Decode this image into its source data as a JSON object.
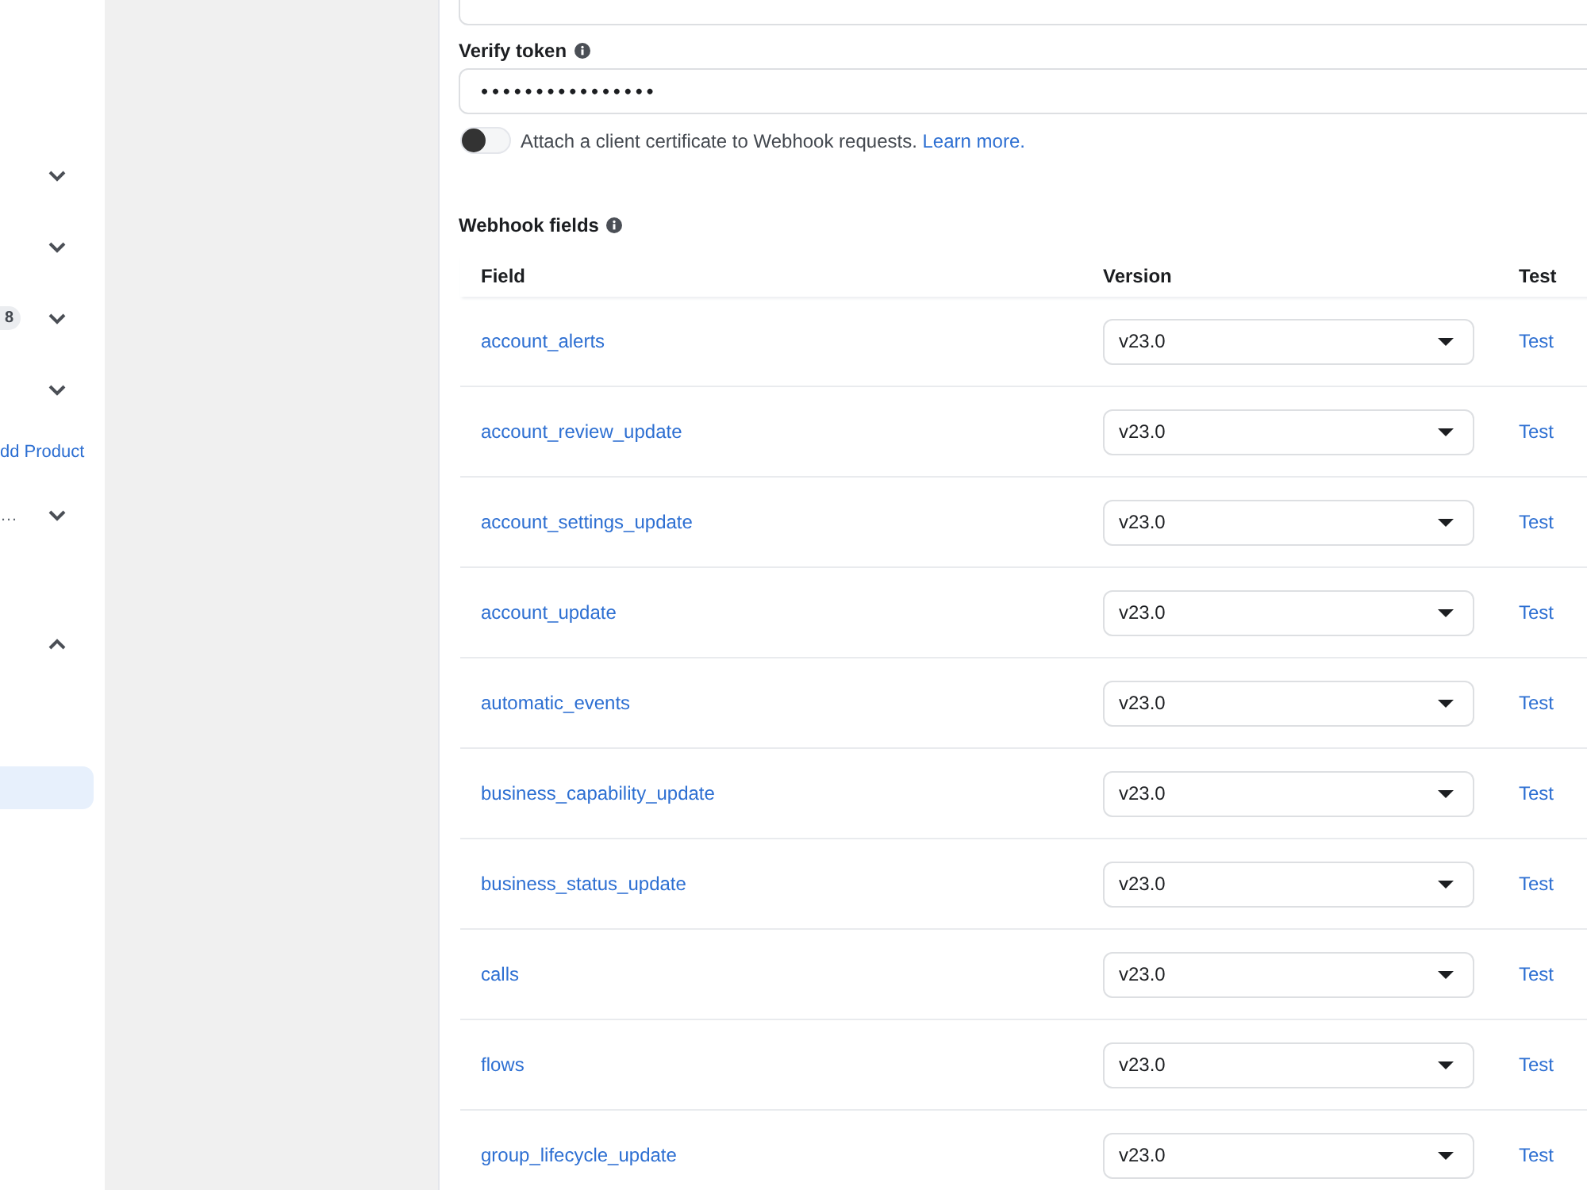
{
  "sidebar": {
    "items": [
      {
        "kind": "group",
        "expanded": false
      },
      {
        "kind": "group",
        "expanded": false
      },
      {
        "kind": "group",
        "badge": "8",
        "expanded": false
      },
      {
        "kind": "group",
        "expanded": false
      },
      {
        "kind": "link",
        "label": "dd Product"
      },
      {
        "kind": "group",
        "label": "…",
        "expanded": false
      },
      {
        "kind": "group",
        "expanded": true,
        "children": [
          {
            "selected": true
          }
        ]
      }
    ]
  },
  "verify_token": {
    "label": "Verify token",
    "value": "••••••••••••••••"
  },
  "client_certificate": {
    "on": false,
    "text": "Attach a client certificate to Webhook requests.",
    "link": "Learn more."
  },
  "webhook_fields": {
    "title": "Webhook fields",
    "columns": [
      "Field",
      "Version",
      "Test"
    ],
    "rows": [
      {
        "field": "account_alerts",
        "version": "v23.0",
        "test": "Test"
      },
      {
        "field": "account_review_update",
        "version": "v23.0",
        "test": "Test"
      },
      {
        "field": "account_settings_update",
        "version": "v23.0",
        "test": "Test"
      },
      {
        "field": "account_update",
        "version": "v23.0",
        "test": "Test"
      },
      {
        "field": "automatic_events",
        "version": "v23.0",
        "test": "Test"
      },
      {
        "field": "business_capability_update",
        "version": "v23.0",
        "test": "Test"
      },
      {
        "field": "business_status_update",
        "version": "v23.0",
        "test": "Test"
      },
      {
        "field": "calls",
        "version": "v23.0",
        "test": "Test"
      },
      {
        "field": "flows",
        "version": "v23.0",
        "test": "Test"
      },
      {
        "field": "group_lifecycle_update",
        "version": "v23.0",
        "test": "Test"
      }
    ]
  }
}
